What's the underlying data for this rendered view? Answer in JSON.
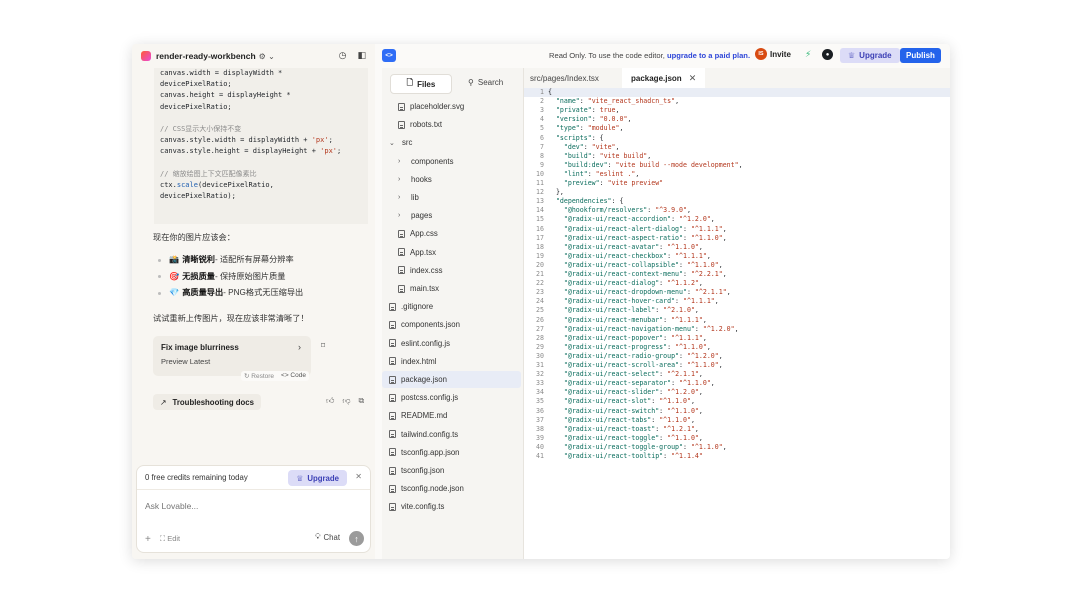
{
  "header": {
    "project_name": "render-ready-workbench",
    "project_icons": "⚙ ⌄"
  },
  "chat": {
    "code_lines": [
      [
        [
          "p",
          "canvas.width = displayWidth *"
        ]
      ],
      [
        [
          "p",
          "devicePixelRatio;"
        ]
      ],
      [
        [
          "p",
          "canvas.height = displayHeight *"
        ]
      ],
      [
        [
          "p",
          "devicePixelRatio;"
        ]
      ],
      [
        [
          "p",
          ""
        ]
      ],
      [
        [
          "cm",
          "// CSS显示大小保持不变"
        ]
      ],
      [
        [
          "p",
          "canvas.style.width = displayWidth + "
        ],
        [
          "str",
          "'px'"
        ],
        [
          "p",
          ";"
        ]
      ],
      [
        [
          "p",
          "canvas.style.height = displayHeight + "
        ],
        [
          "str",
          "'px'"
        ],
        [
          "p",
          ";"
        ]
      ],
      [
        [
          "p",
          ""
        ]
      ],
      [
        [
          "cm",
          "// 缩放绘图上下文匹配像素比"
        ]
      ],
      [
        [
          "p",
          "ctx."
        ],
        [
          "fn",
          "scale"
        ],
        [
          "p",
          "(devicePixelRatio,"
        ]
      ],
      [
        [
          "p",
          "devicePixelRatio);"
        ]
      ]
    ],
    "result_intro": "现在你的图片应该会：",
    "bullets": [
      {
        "emoji": "📸",
        "bold": "清晰锐利",
        "rest": " - 适配所有屏幕分辨率"
      },
      {
        "emoji": "🎯",
        "bold": "无损质量",
        "rest": " - 保持原始图片质量"
      },
      {
        "emoji": "💎",
        "bold": "高质量导出",
        "rest": " - PNG格式无压缩导出"
      }
    ],
    "retry_text": "试试重新上传图片，现在应该非常清晰了！",
    "fix_card": {
      "title": "Fix image blurriness",
      "subtitle": "Preview Latest"
    },
    "restore_label": "Restore",
    "code_label": "<> Code",
    "troubleshooting_label": "Troubleshooting docs"
  },
  "composer": {
    "credits_text": "0 free credits remaining today",
    "upgrade_label": "Upgrade",
    "placeholder": "Ask Lovable...",
    "edit_label": "Edit",
    "chat_label": "Chat"
  },
  "topbar": {
    "readonly_text": "Read Only. To use the code editor,",
    "readonly_link": "upgrade to a paid plan.",
    "invite_label": "Invite",
    "avatar_initials": "IS",
    "upgrade_label": "Upgrade",
    "publish_label": "Publish"
  },
  "filetree": {
    "files_tab": "Files",
    "search_tab": "Search",
    "items": [
      {
        "name": "placeholder.svg",
        "type": "file",
        "indent": 1
      },
      {
        "name": "robots.txt",
        "type": "file",
        "indent": 1
      },
      {
        "name": "src",
        "type": "folder-open",
        "indent": 0
      },
      {
        "name": "components",
        "type": "folder",
        "indent": 1
      },
      {
        "name": "hooks",
        "type": "folder",
        "indent": 1
      },
      {
        "name": "lib",
        "type": "folder",
        "indent": 1
      },
      {
        "name": "pages",
        "type": "folder",
        "indent": 1
      },
      {
        "name": "App.css",
        "type": "file",
        "indent": 1
      },
      {
        "name": "App.tsx",
        "type": "file",
        "indent": 1
      },
      {
        "name": "index.css",
        "type": "file",
        "indent": 1
      },
      {
        "name": "main.tsx",
        "type": "file",
        "indent": 1
      },
      {
        "name": ".gitignore",
        "type": "file",
        "indent": 0
      },
      {
        "name": "components.json",
        "type": "file",
        "indent": 0
      },
      {
        "name": "eslint.config.js",
        "type": "file",
        "indent": 0
      },
      {
        "name": "index.html",
        "type": "file",
        "indent": 0
      },
      {
        "name": "package.json",
        "type": "file",
        "indent": 0,
        "active": true
      },
      {
        "name": "postcss.config.js",
        "type": "file",
        "indent": 0
      },
      {
        "name": "README.md",
        "type": "file",
        "indent": 0
      },
      {
        "name": "tailwind.config.ts",
        "type": "file",
        "indent": 0
      },
      {
        "name": "tsconfig.app.json",
        "type": "file",
        "indent": 0
      },
      {
        "name": "tsconfig.json",
        "type": "file",
        "indent": 0
      },
      {
        "name": "tsconfig.node.json",
        "type": "file",
        "indent": 0
      },
      {
        "name": "vite.config.ts",
        "type": "file",
        "indent": 0
      }
    ]
  },
  "editor": {
    "breadcrumb": "src/pages/Index.tsx",
    "active_tab": "package.json",
    "lines": [
      "{",
      "  \"name\": \"vite_react_shadcn_ts\",",
      "  \"private\": true,",
      "  \"version\": \"0.0.0\",",
      "  \"type\": \"module\",",
      "  \"scripts\": {",
      "    \"dev\": \"vite\",",
      "    \"build\": \"vite build\",",
      "    \"build:dev\": \"vite build --mode development\",",
      "    \"lint\": \"eslint .\",",
      "    \"preview\": \"vite preview\"",
      "  },",
      "  \"dependencies\": {",
      "    \"@hookform/resolvers\": \"^3.9.0\",",
      "    \"@radix-ui/react-accordion\": \"^1.2.0\",",
      "    \"@radix-ui/react-alert-dialog\": \"^1.1.1\",",
      "    \"@radix-ui/react-aspect-ratio\": \"^1.1.0\",",
      "    \"@radix-ui/react-avatar\": \"^1.1.0\",",
      "    \"@radix-ui/react-checkbox\": \"^1.1.1\",",
      "    \"@radix-ui/react-collapsible\": \"^1.1.0\",",
      "    \"@radix-ui/react-context-menu\": \"^2.2.1\",",
      "    \"@radix-ui/react-dialog\": \"^1.1.2\",",
      "    \"@radix-ui/react-dropdown-menu\": \"^2.1.1\",",
      "    \"@radix-ui/react-hover-card\": \"^1.1.1\",",
      "    \"@radix-ui/react-label\": \"^2.1.0\",",
      "    \"@radix-ui/react-menubar\": \"^1.1.1\",",
      "    \"@radix-ui/react-navigation-menu\": \"^1.2.0\",",
      "    \"@radix-ui/react-popover\": \"^1.1.1\",",
      "    \"@radix-ui/react-progress\": \"^1.1.0\",",
      "    \"@radix-ui/react-radio-group\": \"^1.2.0\",",
      "    \"@radix-ui/react-scroll-area\": \"^1.1.0\",",
      "    \"@radix-ui/react-select\": \"^2.1.1\",",
      "    \"@radix-ui/react-separator\": \"^1.1.0\",",
      "    \"@radix-ui/react-slider\": \"^1.2.0\",",
      "    \"@radix-ui/react-slot\": \"^1.1.0\",",
      "    \"@radix-ui/react-switch\": \"^1.1.0\",",
      "    \"@radix-ui/react-tabs\": \"^1.1.0\",",
      "    \"@radix-ui/react-toast\": \"^1.2.1\",",
      "    \"@radix-ui/react-toggle\": \"^1.1.0\",",
      "    \"@radix-ui/react-toggle-group\": \"^1.1.0\",",
      "    \"@radix-ui/react-tooltip\": \"^1.1.4\""
    ]
  },
  "colors": {
    "accent": "#2463eb",
    "upgrade_bg": "#dcdcf7",
    "upgrade_text": "#3b3fb5",
    "string": "#b3361c",
    "key": "#0b6d5d"
  }
}
